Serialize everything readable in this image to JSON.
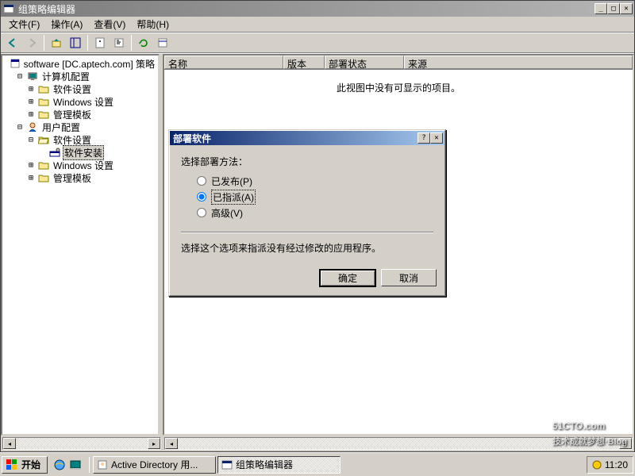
{
  "window": {
    "title": "组策略编辑器"
  },
  "menu": {
    "file": "文件(F)",
    "action": "操作(A)",
    "view": "查看(V)",
    "help": "帮助(H)"
  },
  "tree": {
    "root": "software [DC.aptech.com] 策略",
    "computer_config": "计算机配置",
    "software_settings1": "软件设置",
    "windows_settings1": "Windows 设置",
    "admin_templates1": "管理模板",
    "user_config": "用户配置",
    "software_settings2": "软件设置",
    "software_install": "软件安装",
    "windows_settings2": "Windows 设置",
    "admin_templates2": "管理模板"
  },
  "list": {
    "columns": {
      "name": "名称",
      "version": "版本",
      "deployment": "部署状态",
      "source": "来源"
    },
    "empty_message": "此视图中没有可显示的项目。"
  },
  "dialog": {
    "title": "部署软件",
    "prompt": "选择部署方法：",
    "opt_published": "已发布(P)",
    "opt_assigned": "已指派(A)",
    "opt_advanced": "高级(V)",
    "description": "选择这个选项来指派没有经过修改的应用程序。",
    "ok": "确定",
    "cancel": "取消"
  },
  "taskbar": {
    "start": "开始",
    "app1": "Active Directory 用...",
    "app2": "组策略编辑器",
    "clock": "11:20"
  },
  "watermark": {
    "main": "51CTO.com",
    "sub": "技术成就梦想·Blog"
  }
}
